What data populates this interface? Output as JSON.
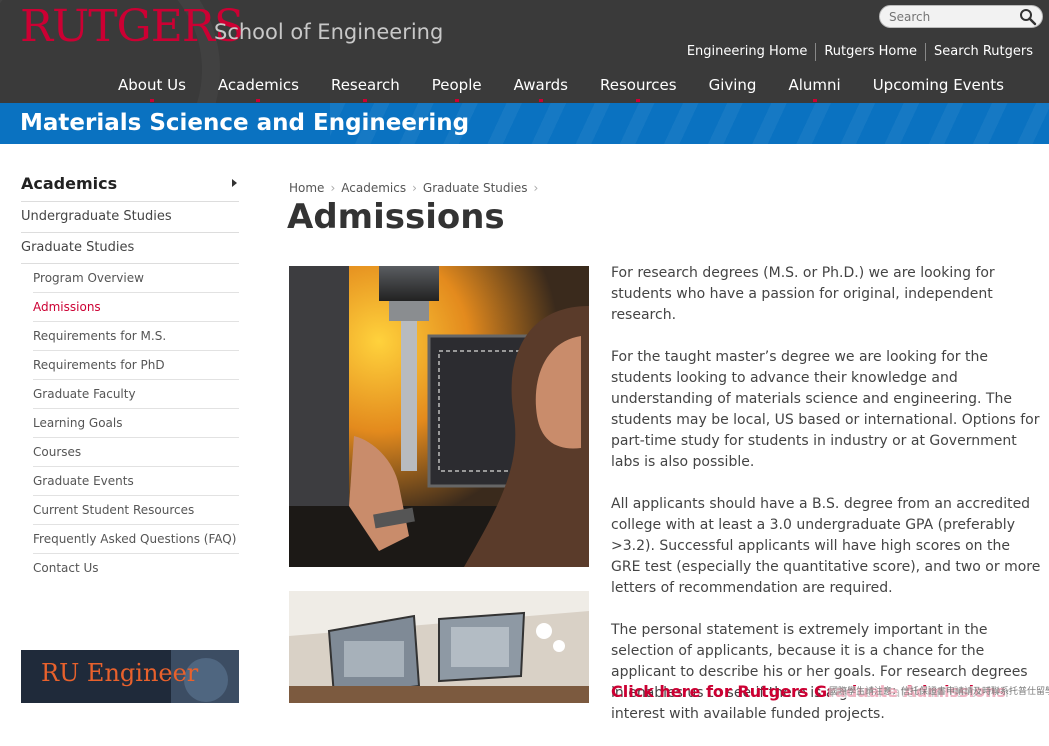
{
  "header": {
    "logo": "RUTGERS",
    "school": "School of Engineering",
    "search_placeholder": "Search",
    "utility_links": [
      "Engineering Home",
      "Rutgers Home",
      "Search Rutgers"
    ],
    "nav": [
      "About Us",
      "Academics",
      "Research",
      "People",
      "Awards",
      "Resources",
      "Giving",
      "Alumni",
      "Upcoming Events"
    ]
  },
  "banner": {
    "title": "Materials Science and Engineering"
  },
  "sidebar": {
    "heading": "Academics",
    "top_items": [
      "Undergraduate Studies",
      "Graduate Studies"
    ],
    "sub_items": [
      "Program Overview",
      "Admissions",
      "Requirements for M.S.",
      "Requirements for PhD",
      "Graduate Faculty",
      "Learning Goals",
      "Courses",
      "Graduate Events",
      "Current Student Resources",
      "Frequently Asked Questions (FAQ)",
      "Contact Us"
    ],
    "active_item": "Admissions",
    "promo": "RU Engineer"
  },
  "breadcrumb": [
    "Home",
    "Academics",
    "Graduate Studies"
  ],
  "page": {
    "title": "Admissions",
    "paragraphs": [
      "For research degrees (M.S. or Ph.D.) we are looking for students who have a passion for original, independent research.",
      "For the taught master’s degree we are looking for the students looking to advance their knowledge and understanding of materials science and engineering. The students may be local, US based or international. Options for part-time study for students in industry or at Government labs is also possible.",
      "All applicants should have a B.S. degree from an accredited college with at least a 3.0 undergraduate GPA (preferably >3.2). Successful applicants will have high scores on the GRE test (especially the quantitative score), and two or more letters of recommendation are required.",
      "The personal statement is extremely important in the selection of applicants, because it is a chance for the applicant to describe his or her goals. For research degrees in enables us to see if there is a good match in his or her interest with available funded projects."
    ],
    "cta": "Click here for Rutgers Graduate Admissions",
    "footnote": "國際學生請注意：信托保證書申請請及時聯系托普仕留學顧問"
  },
  "colors": {
    "brand_red": "#cc0033",
    "banner_blue": "#0a72c1",
    "header_dark": "#3a3a3a"
  }
}
